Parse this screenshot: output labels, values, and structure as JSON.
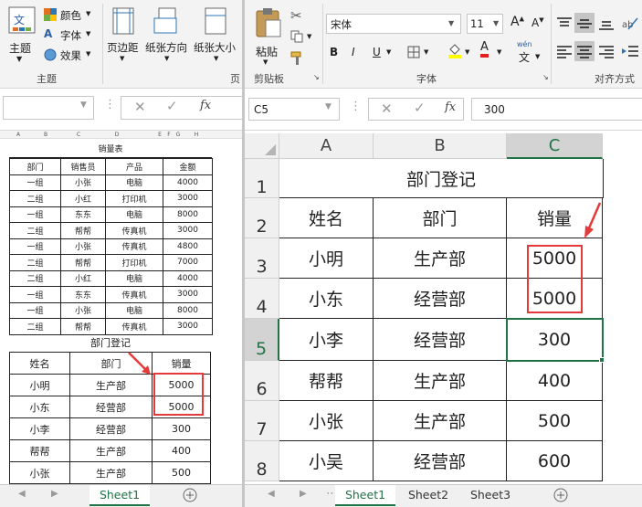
{
  "left_window": {
    "ribbon": {
      "theme_group": {
        "themes_label": "主题",
        "colors_label": "颜色",
        "fonts_label": "字体",
        "effects_label": "效果",
        "group_label": "主题"
      },
      "page_setup": {
        "margins_label": "页边距",
        "orientation_label": "纸张方向",
        "size_label": "纸张大小",
        "group_label_partial": "页"
      }
    },
    "formula_bar": {
      "fx": "fx"
    },
    "mini_sheet": {
      "col_letters": [
        "A",
        "B",
        "C",
        "D",
        "E",
        "F",
        "G",
        "H"
      ],
      "sales_title": "销量表",
      "sales_headers": [
        "部门",
        "销售员",
        "产品",
        "金额"
      ],
      "sales_rows": [
        [
          "一组",
          "小张",
          "电脑",
          "4000"
        ],
        [
          "二组",
          "小红",
          "打印机",
          "3000"
        ],
        [
          "一组",
          "东东",
          "电脑",
          "8000"
        ],
        [
          "二组",
          "帮帮",
          "传真机",
          "3000"
        ],
        [
          "一组",
          "小张",
          "传真机",
          "4800"
        ],
        [
          "二组",
          "帮帮",
          "打印机",
          "7000"
        ],
        [
          "二组",
          "小红",
          "电脑",
          "4000"
        ],
        [
          "一组",
          "东东",
          "传真机",
          "3000"
        ],
        [
          "一组",
          "小张",
          "电脑",
          "8000"
        ],
        [
          "二组",
          "帮帮",
          "传真机",
          "3000"
        ]
      ],
      "dept_title": "部门登记",
      "dept_headers": [
        "姓名",
        "部门",
        "销量"
      ],
      "dept_rows": [
        [
          "小明",
          "生产部",
          "5000"
        ],
        [
          "小东",
          "经营部",
          "5000"
        ],
        [
          "小李",
          "经营部",
          "300"
        ],
        [
          "帮帮",
          "生产部",
          "400"
        ],
        [
          "小张",
          "生产部",
          "500"
        ]
      ]
    },
    "sheet_tab": "Sheet1"
  },
  "right_window": {
    "ribbon": {
      "paste_label": "粘贴",
      "clipboard_label": "剪贴板",
      "font_name": "宋体",
      "font_size": "11",
      "bold": "B",
      "italic": "I",
      "underline": "U",
      "wen_label": "wén",
      "wen_char": "文",
      "font_group_label": "字体",
      "align_group_label": "对齐方式"
    },
    "formula_bar": {
      "name_box": "C5",
      "fx": "fx",
      "value": "300"
    },
    "columns": [
      "A",
      "B",
      "C"
    ],
    "rows": [
      "1",
      "2",
      "3",
      "4",
      "5",
      "6",
      "7",
      "8"
    ],
    "title": "部门登记",
    "headers": [
      "姓名",
      "部门",
      "销量"
    ],
    "data": [
      [
        "小明",
        "生产部",
        "5000"
      ],
      [
        "小东",
        "经营部",
        "5000"
      ],
      [
        "小李",
        "经营部",
        "300"
      ],
      [
        "帮帮",
        "生产部",
        "400"
      ],
      [
        "小张",
        "生产部",
        "500"
      ],
      [
        "小吴",
        "经营部",
        "600"
      ]
    ],
    "tabs": [
      "Sheet1",
      "Sheet2",
      "Sheet3"
    ]
  }
}
